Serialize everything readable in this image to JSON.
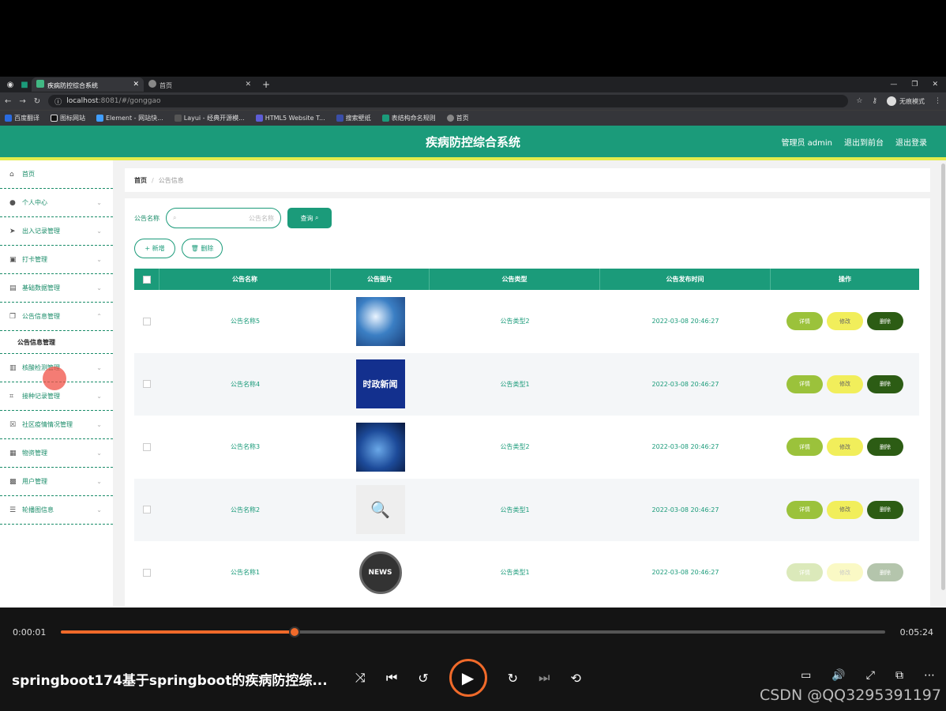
{
  "browser": {
    "tabs": [
      {
        "label": "疾病防控综合系统",
        "active": true
      },
      {
        "label": "首页",
        "active": false
      }
    ],
    "url_host": "localhost",
    "url_path": ":8081/#/gonggao",
    "profile_label": "无痕模式",
    "bookmarks": [
      "百度翻译",
      "图标网站",
      "Element - 网站快...",
      "Layui - 经典开源模...",
      "HTML5 Website T...",
      "搜索壁纸",
      "表结构命名规则",
      "首页"
    ]
  },
  "app": {
    "title": "疾病防控综合系统",
    "admin_label": "管理员 admin",
    "front_link": "退出到前台",
    "logout_link": "退出登录"
  },
  "sidebar": {
    "items": [
      {
        "label": "首页",
        "icon": "home-icon"
      },
      {
        "label": "个人中心",
        "icon": "user-icon"
      },
      {
        "label": "出入记录管理",
        "icon": "send-icon"
      },
      {
        "label": "打卡管理",
        "icon": "briefcase-icon"
      },
      {
        "label": "基础数据管理",
        "icon": "doc-icon"
      },
      {
        "label": "公告信息管理",
        "icon": "copy-icon"
      },
      {
        "label": "核酸检测管理",
        "icon": "chart-icon"
      },
      {
        "label": "接种记录管理",
        "icon": "crop-icon"
      },
      {
        "label": "社区疫情情况管理",
        "icon": "stamp-icon"
      },
      {
        "label": "物资管理",
        "icon": "box-icon"
      },
      {
        "label": "用户管理",
        "icon": "lock-icon"
      },
      {
        "label": "轮播图信息",
        "icon": "sliders-icon"
      }
    ],
    "sub_item": "公告信息管理"
  },
  "breadcrumb": {
    "home": "首页",
    "sep": "/",
    "current": "公告信息"
  },
  "search": {
    "label": "公告名称",
    "placeholder": "公告名称",
    "button": "查询"
  },
  "actions": {
    "add": "新增",
    "delete": "删除"
  },
  "table": {
    "headers": [
      "公告名称",
      "公告图片",
      "公告类型",
      "公告发布时间",
      "操作"
    ],
    "rows": [
      {
        "name": "公告名称5",
        "type": "公告类型2",
        "time": "2022-03-08 20:46:27"
      },
      {
        "name": "公告名称4",
        "type": "公告类型1",
        "time": "2022-03-08 20:46:27",
        "image_text": "时政新闻"
      },
      {
        "name": "公告名称3",
        "type": "公告类型2",
        "time": "2022-03-08 20:46:27"
      },
      {
        "name": "公告名称2",
        "type": "公告类型1",
        "time": "2022-03-08 20:46:27"
      },
      {
        "name": "公告名称1",
        "type": "公告类型1",
        "time": "2022-03-08 20:46:27",
        "image_text": "NEWS"
      }
    ],
    "op_buttons": {
      "detail": "详情",
      "edit": "修改",
      "delete": "删除"
    }
  },
  "player": {
    "current_time": "0:00:01",
    "total_time": "0:05:24",
    "progress": 0.284,
    "video_title": "springboot174基于springboot的疾病防控综..."
  },
  "watermark": "CSDN @QQ3295391197",
  "colors": {
    "primary": "#1b9b7a",
    "accent_bar": "#e3ec4c",
    "progress": "#f06a2a"
  }
}
